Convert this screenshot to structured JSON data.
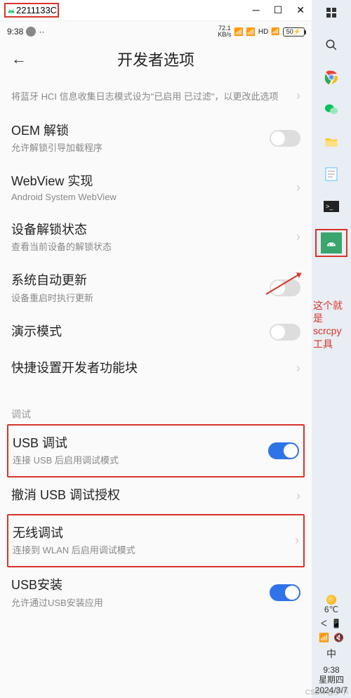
{
  "window": {
    "title": "2211133C"
  },
  "phone_status": {
    "time": "9:38",
    "data_rate": "72.1",
    "data_unit": "KB/s",
    "hd": "HD",
    "battery": "50"
  },
  "page": {
    "title": "开发者选项"
  },
  "rows": {
    "bt_partial": "将蓝牙 HCI 信息收集日志模式设为\"已启用 已过滤\"，以更改此选项",
    "oem_title": "OEM 解锁",
    "oem_sub": "允许解锁引导加载程序",
    "webview_title": "WebView 实现",
    "webview_sub": "Android System WebView",
    "unlock_title": "设备解锁状态",
    "unlock_sub": "查看当前设备的解锁状态",
    "autoupdate_title": "系统自动更新",
    "autoupdate_sub": "设备重启时执行更新",
    "demo_title": "演示模式",
    "quick_title": "快捷设置开发者功能块",
    "usb_debug_title": "USB 调试",
    "usb_debug_sub": "连接 USB 后启用调试模式",
    "revoke_title": "撤消 USB 调试授权",
    "wireless_title": "无线调试",
    "wireless_sub": "连接到 WLAN 后启用调试模式",
    "usb_install_title": "USB安装",
    "usb_install_sub": "允许通过USB安装应用"
  },
  "section": {
    "debug": "调试"
  },
  "annotation": {
    "line1": "这个就是",
    "line2": "scrcpy工具"
  },
  "systray": {
    "temp": "6℃",
    "ime": "中",
    "time": "9:38",
    "weekday": "星期四",
    "date": "2024/3/7"
  },
  "watermark": "CSDN @罗小"
}
